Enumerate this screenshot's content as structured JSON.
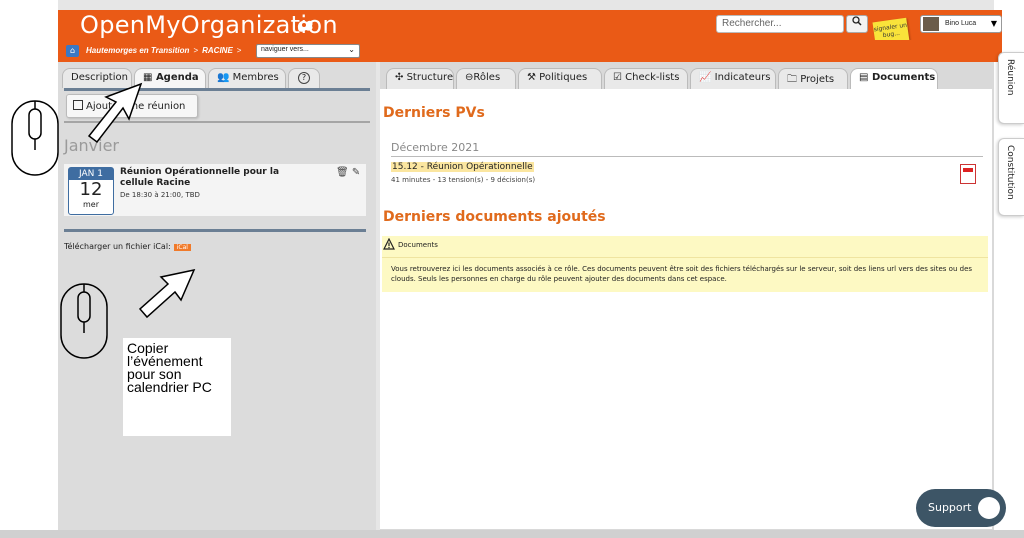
{
  "app": {
    "title": "OpenMyOrganization",
    "search_placeholder": "Rechercher...",
    "bug_note": "signaler un bug...",
    "user_name": "Bino Luca"
  },
  "breadcrumb": {
    "items": [
      "Hautemorges en Transition",
      "RACINE"
    ],
    "nav_select": "naviguer vers..."
  },
  "left_tabs": [
    "Description",
    "Agenda",
    "Membres",
    "?"
  ],
  "agenda": {
    "add_button": "Ajouter une réunion",
    "month": "Janvier",
    "event": {
      "month_short": "JAN 1",
      "day": "12",
      "weekday": "mer",
      "title": "Réunion Opérationnelle pour la cellule Racine",
      "time": "De 18:30 à 21:00, TBD"
    },
    "ical_label": "Télécharger un fichier iCal:",
    "ical_badge": "iCal"
  },
  "right_tabs": [
    "Structure",
    "Rôles",
    "Politiques",
    "Check-lists",
    "Indicateurs",
    "Projets",
    "Documents"
  ],
  "documents": {
    "pv_heading": "Derniers PVs",
    "pv_month": "Décembre 2021",
    "pv_title": "15.12 - Réunion Opérationnelle",
    "pv_meta": "41 minutes - 13 tension(s) - 9 décision(s)",
    "docs_heading": "Derniers documents ajoutés",
    "notice_title": "Documents",
    "notice_text": "Vous retrouverez ici les documents associés à ce rôle. Ces documents peuvent être soit des fichiers téléchargés sur le serveur, soit des liens url vers des sites ou des clouds. Seuls les personnes en charge du rôle peuvent ajouter des documents dans cet espace."
  },
  "side_tabs": [
    "Réunion",
    "Constitution"
  ],
  "support_label": "Support",
  "annotation": "Copier l’événement pour son calendrier PC",
  "colors": {
    "brand_orange": "#ea5a16",
    "heading_orange": "#e06a1c",
    "agenda_blue": "#3f6da1",
    "notice_yellow": "#fdf9c3"
  }
}
